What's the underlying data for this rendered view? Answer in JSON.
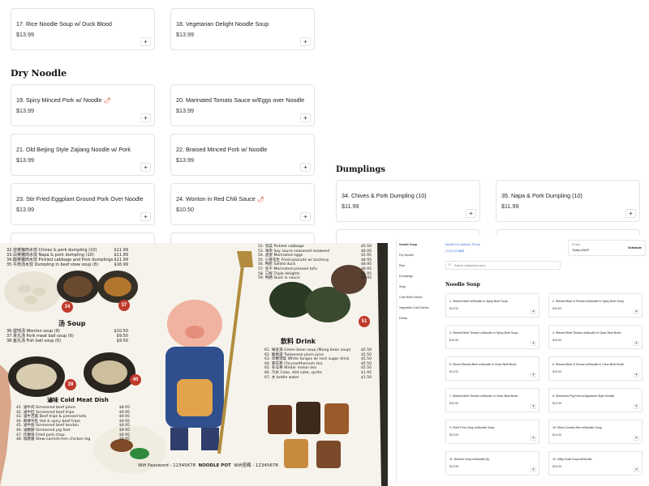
{
  "top_items": [
    {
      "name": "17. Rice Noodle Soup w/ Duck Blood",
      "price": "$13.99",
      "add": "+"
    },
    {
      "name": "18. Vegetarian Delight Noodle Soup",
      "price": "$13.99",
      "add": "+"
    }
  ],
  "dry_noodle": {
    "title": "Dry Noodle",
    "items": [
      {
        "name": "19. Spicy Minced Pork w/ Noodle",
        "price": "$13.99",
        "add": "+",
        "spicy": "🌶"
      },
      {
        "name": "20. Marinated Tomato Sauce w/Eggs over Noodle",
        "price": "$13.99",
        "add": "+"
      },
      {
        "name": "21. Old Beijing Style Zajiang Noodle w/ Pork",
        "price": "$13.99",
        "add": "+"
      },
      {
        "name": "22. Braised Minced Pork w/ Noodle",
        "price": "$13.99",
        "add": "+"
      },
      {
        "name": "23. Stir Fried Eggplant Ground Pork Over Noodle",
        "price": "$13.99",
        "add": "+"
      },
      {
        "name": "24. Wonton in Red Chili Sauce",
        "price": "$10.50",
        "add": "+",
        "spicy": "🌶"
      }
    ]
  },
  "dumplings": {
    "title": "Dumplings",
    "items": [
      {
        "name": "34. Chives & Pork Dumpling (10)",
        "price": "$11.99",
        "add": "+"
      },
      {
        "name": "35. Napa & Pork Dumpling (10)",
        "price": "$11.99",
        "add": "+"
      }
    ]
  },
  "photo": {
    "top_left_menu": [
      {
        "cn": "32.韭菜猪肉水饺",
        "en": "Chives & pork dumpling (10)",
        "price": "$11.99"
      },
      {
        "cn": "33.白菜猪肉水饺",
        "en": "Napa & pork dumpling (10)",
        "price": "$11.99"
      },
      {
        "cn": "34.酸菜猪肉水饺",
        "en": "Pickled cabbage and Pork dumplings",
        "price": "$11.99"
      },
      {
        "cn": "35.牛肉汤水饺",
        "en": "Dumpling in beef stew soup (8)",
        "price": "$16.99"
      }
    ],
    "soup_title": "汤 Soup",
    "soup_items": [
      {
        "cn": "36.馄饨汤",
        "en": "Wonton soup (8)",
        "price": "$10.50"
      },
      {
        "cn": "37.贡丸汤",
        "en": "Pork meat ball soup (6)",
        "price": "$9.50"
      },
      {
        "cn": "38.鱼丸汤",
        "en": "Fish ball soup (6)",
        "price": "$9.50"
      }
    ],
    "cold_title": "滷味 Cold Meat Dish",
    "cold_items": [
      {
        "cn": "41. 滷牛肉",
        "en": "Simmered beef piece",
        "price": "$8.95"
      },
      {
        "cn": "42. 滷牛肚",
        "en": "Simmered beef tripe",
        "price": "$9.95"
      },
      {
        "cn": "43. 滷牛百葉",
        "en": "Beef tripe & pressed tofu",
        "price": "$9.95"
      },
      {
        "cn": "44. 麻辣牛肚",
        "en": "Hot & spicy beef tripe",
        "price": "$9.95"
      },
      {
        "cn": "45. 滷牛筋",
        "en": "Simmered beef tendon",
        "price": "$9.95"
      },
      {
        "cn": "46. 滷豬腳",
        "en": "Simmered pig feet",
        "price": "$9.95"
      },
      {
        "cn": "47. 炸豬排",
        "en": "Fried pork chop",
        "price": "$9.95"
      },
      {
        "cn": "48. 燒春雞",
        "en": "Stew-cornish-hen chicken leg",
        "price": "$9.95"
      }
    ],
    "side_items": [
      {
        "cn": "52. 泡菜",
        "en": "Pickled cabbage",
        "price": "$5.50"
      },
      {
        "cn": "53. 海带",
        "en": "Soy sauce seasoned seaweed",
        "price": "$6.00"
      },
      {
        "cn": "54. 卤蛋",
        "en": "Marinated eggs",
        "price": "$5.95"
      },
      {
        "cn": "55. 小香花生",
        "en": "Fried peanuts w/ anchovy",
        "price": "$8.95"
      },
      {
        "cn": "56. 鸭胗",
        "en": "Salted duck",
        "price": "$8.95"
      },
      {
        "cn": "57. 豆干",
        "en": "Marinated pressed tofu",
        "price": "$8.95"
      },
      {
        "cn": "58. 三鲜",
        "en": "Triple delights",
        "price": "$6.95"
      },
      {
        "cn": "59. 鸭肠",
        "en": "Duck in sauce",
        "price": "$6.95"
      }
    ],
    "drink_title": "飲料 Drink",
    "drink_items": [
      {
        "cn": "61. 綠豆湯",
        "en": "Green bean soup (Mung bean soup)",
        "price": "$5.50"
      },
      {
        "cn": "62. 酸梅湯",
        "en": "Taiwanese plum juice",
        "price": "$5.50"
      },
      {
        "cn": "63. 冰糖雪梨",
        "en": "White fungus w/ rock sugar drink",
        "price": "$5.50"
      },
      {
        "cn": "64. 菊花茶",
        "en": "Chrysanthemum tea",
        "price": "$5.50"
      },
      {
        "cn": "65. 冬瓜茶",
        "en": "Winter melon tea",
        "price": "$5.50"
      },
      {
        "cn": "66. 汽水",
        "en": "Coke, diet coke, sprite",
        "price": "$1.95"
      },
      {
        "cn": "67. 水",
        "en": "bottle water",
        "price": "$1.50"
      }
    ],
    "badges": [
      "34",
      "37",
      "39",
      "40",
      "51"
    ],
    "wifi_left": "Wifi Password : 12345678",
    "brand": "NOODLE POT",
    "wifi_right": "Wifi密碼 : 12345678",
    "colors": {
      "paper": "#f6f3ec",
      "badge": "#c0392b",
      "wall": "#2d2a26"
    }
  },
  "mini": {
    "nav": [
      "Noodle Soup",
      "Dry Noodle",
      "Rice",
      "Dumplings",
      "Soup",
      "Cold Meat Dishes",
      "Vegetable Cold Dishes",
      "Drinks"
    ],
    "address": "Noodle Pot, Address, Phone",
    "phone": "(713) 222-8888",
    "when_label": "Pickup",
    "when_value": "Today ASAP",
    "schedule_label": "Schedule",
    "search_placeholder": "Search restaurant menu",
    "section_title": "Noodle Soup",
    "items": [
      {
        "name": "1. Stewed Beef w/Noodle in Spicy Beef Soup",
        "price": "$14.50",
        "add": "+"
      },
      {
        "name": "2. Stewed Beef & Tendon w/Noodle in Spicy Beef Soup",
        "price": "$16.50",
        "add": "+"
      },
      {
        "name": "3. Stewed Beef Tendon w/Noodle in Spicy Beef Soup",
        "price": "$16.50",
        "add": "+"
      },
      {
        "name": "4. Stewed Beef Tendon w/Noodle in Clear Beef Broth",
        "price": "$16.50",
        "add": "+"
      },
      {
        "name": "5. Sliced Stewed Beef w/Noodle in Clear Beef Broth",
        "price": "$14.50",
        "add": "+"
      },
      {
        "name": "6. Stewed Beef & Tendon w/Noodle in Clear Beef Broth",
        "price": "$16.50",
        "add": "+"
      },
      {
        "name": "7. Stewed Beef Tendon w/Noodle in Clear Beef Broth",
        "price": "$16.50",
        "add": "+"
      },
      {
        "name": "8. Simmered Pig Feet w/Japanese Style Noodle",
        "price": "$13.99",
        "add": "+"
      },
      {
        "name": "9. Fried Pork Chop w/Noodle Soup",
        "price": "$13.99",
        "add": "+"
      },
      {
        "name": "10. Stew-Cornish-Hen w/Noodle Soup",
        "price": "$14.99",
        "add": "+"
      },
      {
        "name": "11. Wonton Soup w/Noodle (8)",
        "price": "$13.99",
        "add": "+"
      },
      {
        "name": "12. Salty Duck Soup w/Noodle",
        "price": "$15.99",
        "add": "+"
      }
    ]
  }
}
